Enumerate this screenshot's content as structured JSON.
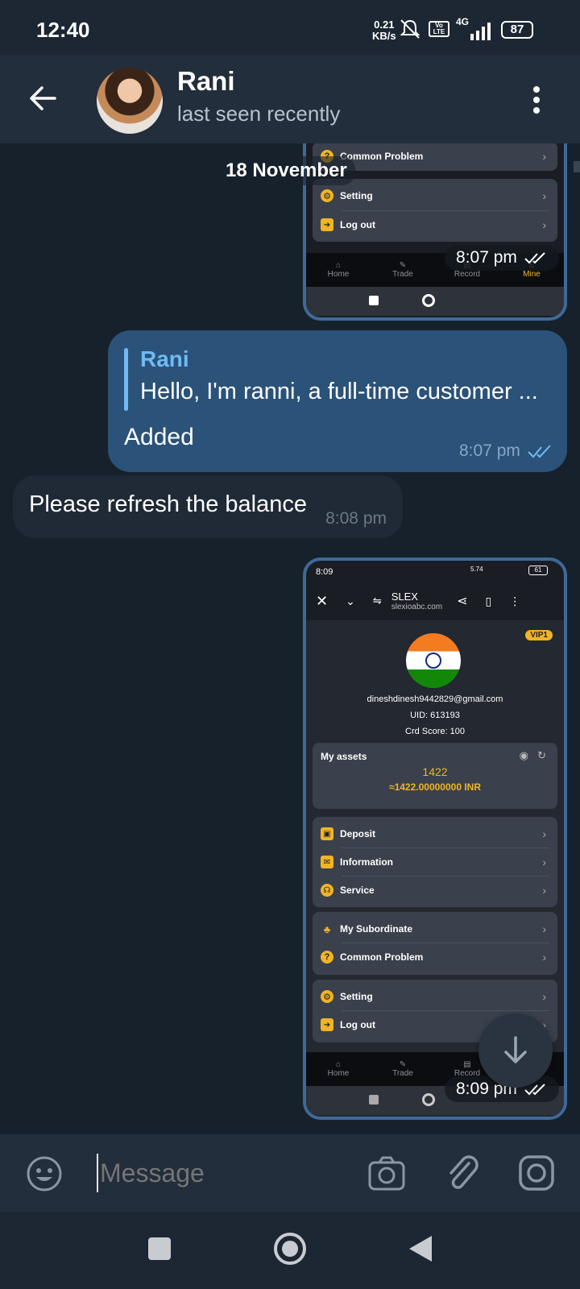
{
  "status_bar": {
    "time": "12:40",
    "rate_top": "0.21",
    "rate_bottom": "KB/s",
    "network": "4G",
    "volte": "Vo LTE",
    "battery": "87"
  },
  "header": {
    "name": "Rani",
    "status": "last seen recently"
  },
  "date_separator": "18 November",
  "first_screenshot": {
    "items": [
      {
        "label": "Common Problem",
        "icon": "question-icon"
      },
      {
        "label": "Setting",
        "icon": "gear-icon"
      },
      {
        "label": "Log out",
        "icon": "logout-icon"
      }
    ],
    "nav": [
      "Home",
      "Trade",
      "Record",
      "Mine"
    ],
    "time": "8:07 pm"
  },
  "outgoing_message": {
    "reply_name": "Rani",
    "reply_text": "Hello, I'm ranni, a full-time customer ...",
    "text": "Added",
    "time": "8:07 pm"
  },
  "incoming_message": {
    "text": "Please refresh the balance",
    "time": "8:08 pm"
  },
  "second_screenshot": {
    "status_time": "8:09",
    "status_rate": "5.74",
    "status_battery": "61",
    "site_name": "SLEX",
    "site_url": "slexioabc.com",
    "vip": "VIP1",
    "email": "dineshdinesh9442829@gmail.com",
    "uid": "UID: 613193",
    "credit": "Crd Score: 100",
    "assets_label": "My assets",
    "assets_value": "1422",
    "assets_inr": "≈1422.00000000 INR",
    "group1": [
      {
        "label": "Deposit",
        "icon": "wallet-icon"
      },
      {
        "label": "Information",
        "icon": "mail-icon"
      },
      {
        "label": "Service",
        "icon": "headset-icon"
      }
    ],
    "group2": [
      {
        "label": "My Subordinate",
        "icon": "org-icon"
      },
      {
        "label": "Common Problem",
        "icon": "question-icon"
      }
    ],
    "group3": [
      {
        "label": "Setting",
        "icon": "gear-icon"
      },
      {
        "label": "Log out",
        "icon": "logout-icon"
      }
    ],
    "nav": [
      "Home",
      "Trade",
      "Record"
    ],
    "time": "8:09 pm"
  },
  "composer": {
    "placeholder": "Message"
  },
  "colors": {
    "bg": "#17212b",
    "header": "#232e3c",
    "outgoing": "#2b5278",
    "accent": "#70baf5",
    "gold": "#f1b427"
  }
}
